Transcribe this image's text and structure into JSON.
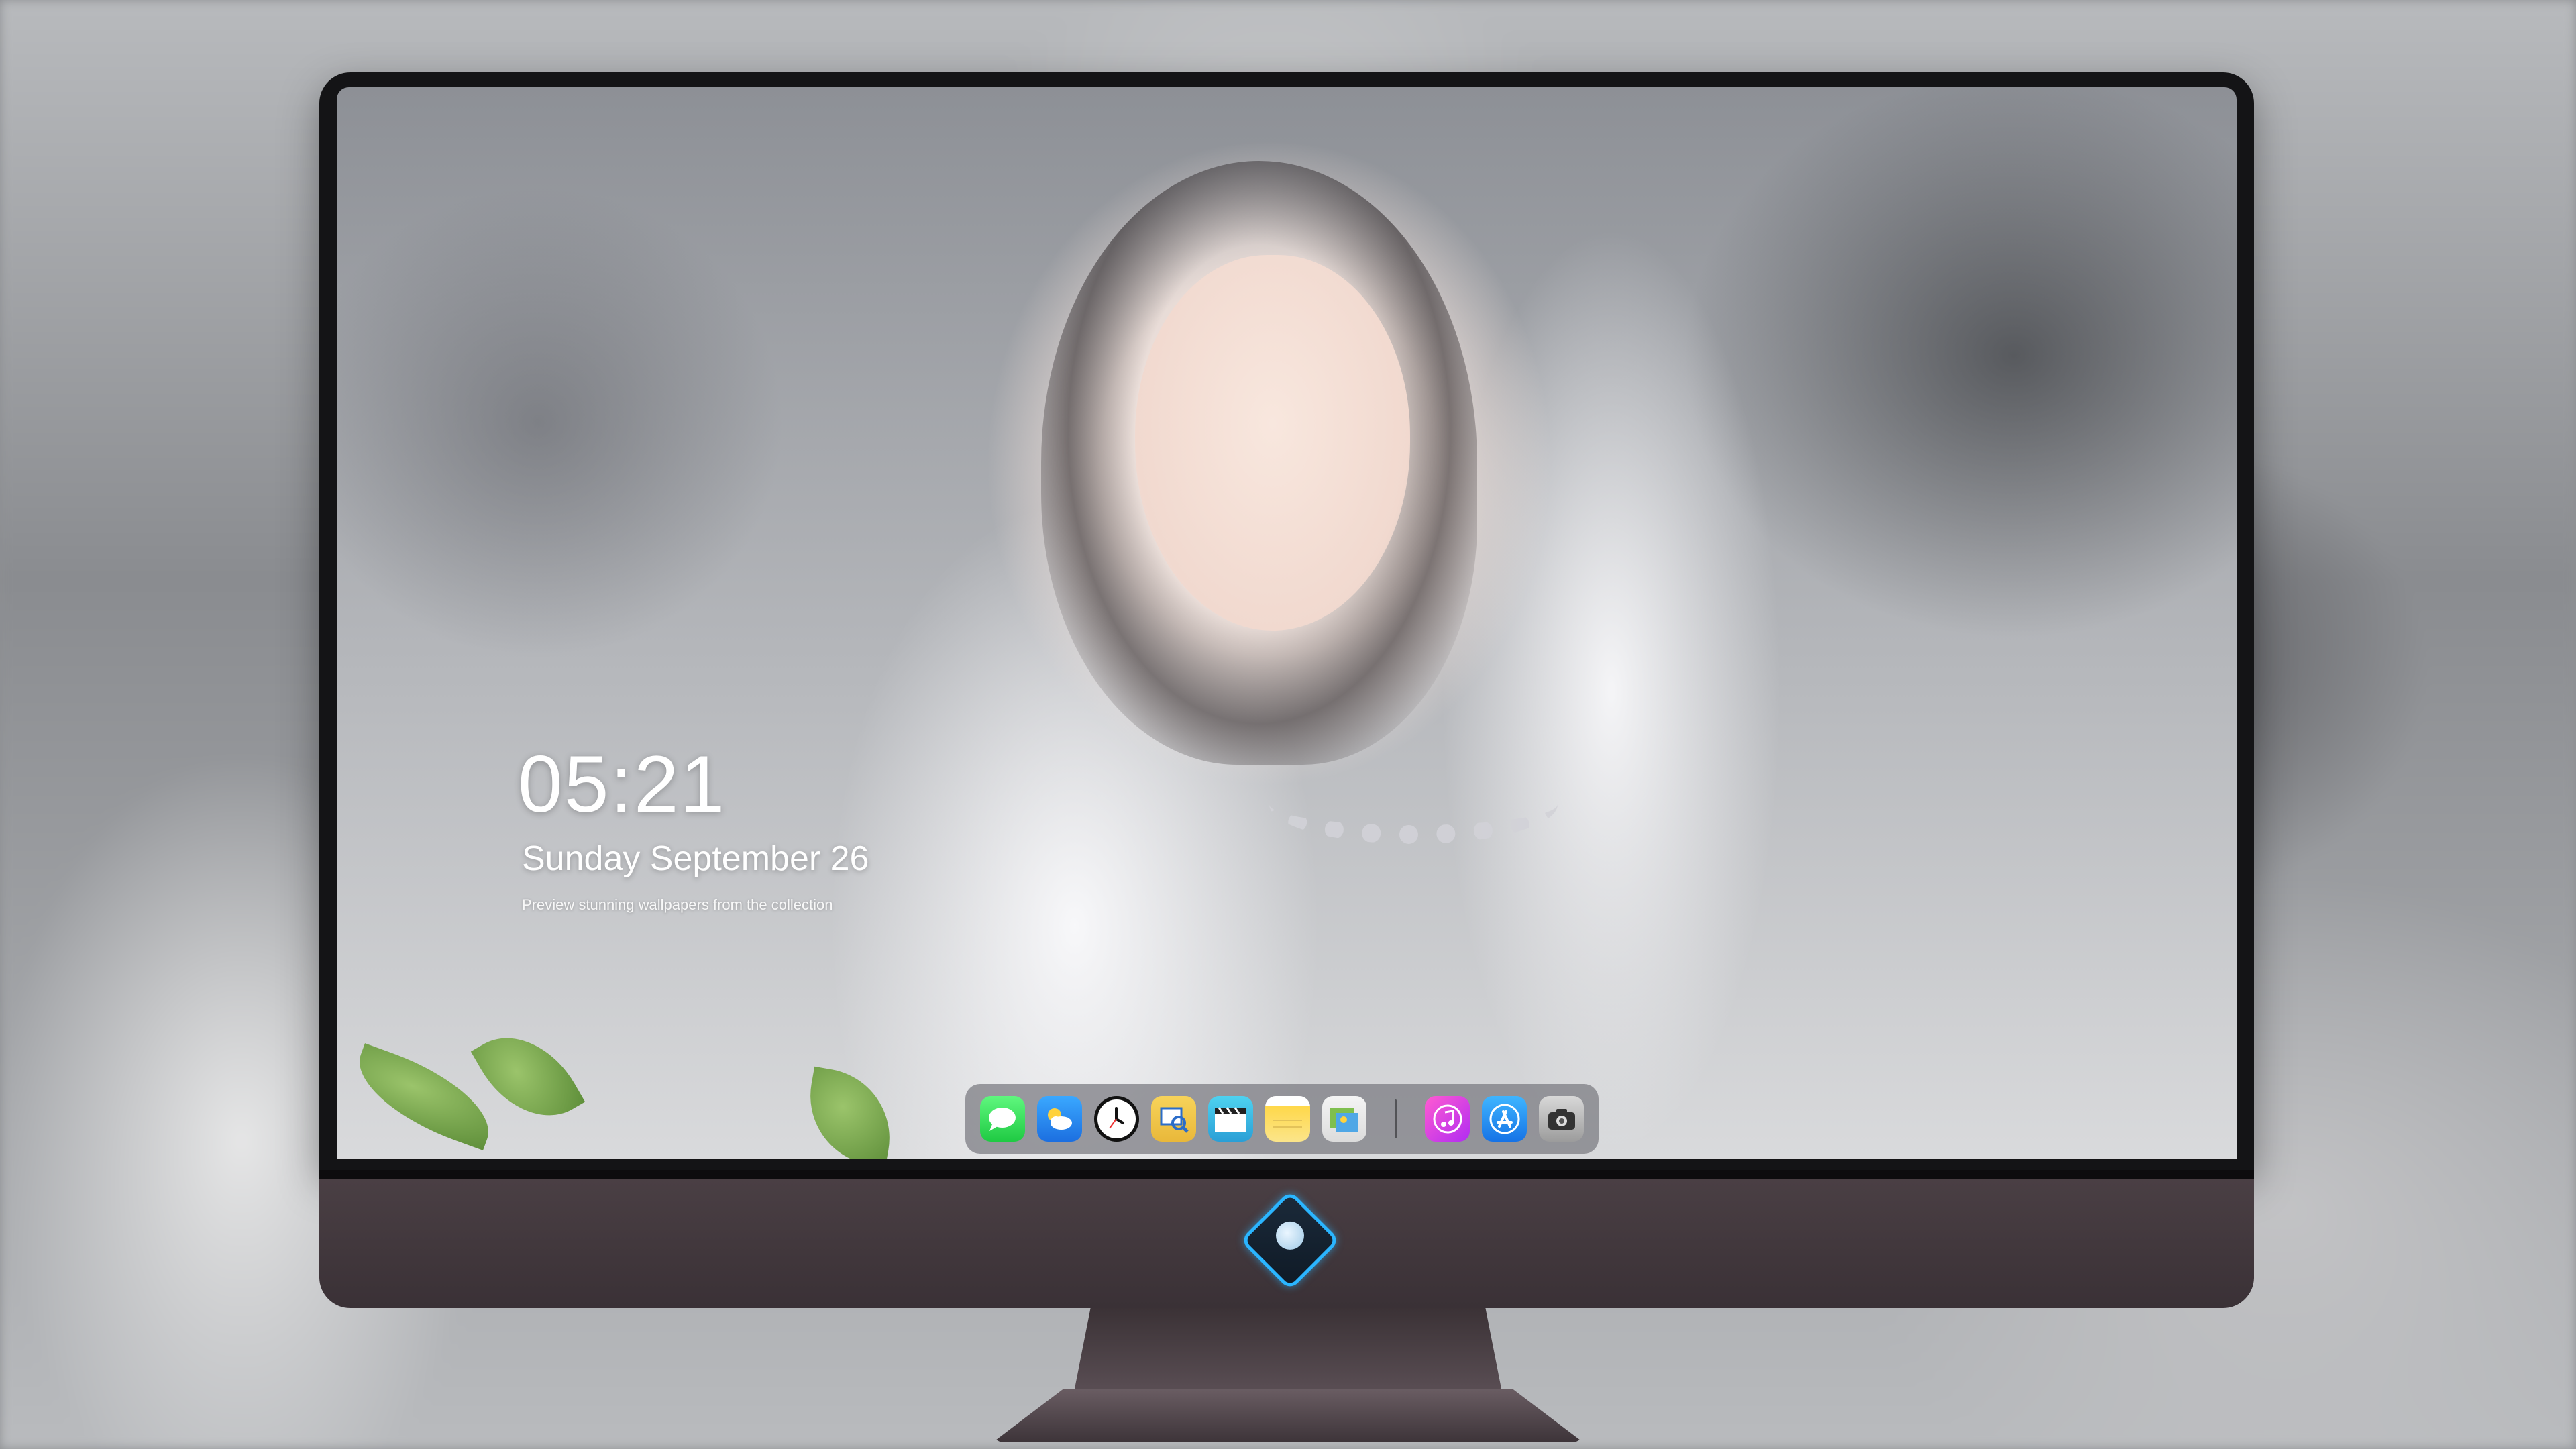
{
  "lock_screen": {
    "time": "05:21",
    "date": "Sunday September 26",
    "caption": "Preview stunning wallpapers from the collection"
  },
  "dock": {
    "apps": [
      {
        "name": "Messages",
        "icon": "messages-icon"
      },
      {
        "name": "Weather",
        "icon": "weather-icon"
      },
      {
        "name": "Clock",
        "icon": "clock-icon"
      },
      {
        "name": "Preview",
        "icon": "preview-icon"
      },
      {
        "name": "Clips",
        "icon": "clips-icon"
      },
      {
        "name": "Notes",
        "icon": "notes-icon"
      },
      {
        "name": "Photos",
        "icon": "photos-icon"
      }
    ],
    "pinned": [
      {
        "name": "Music",
        "icon": "music-icon"
      },
      {
        "name": "App Store",
        "icon": "app-store-icon"
      },
      {
        "name": "Camera",
        "icon": "camera-icon"
      }
    ]
  },
  "colors": {
    "bezel": "#141416",
    "chin": "#4a3f44",
    "dock_background": "#78787f",
    "logo_accent": "#2ab5ff"
  }
}
